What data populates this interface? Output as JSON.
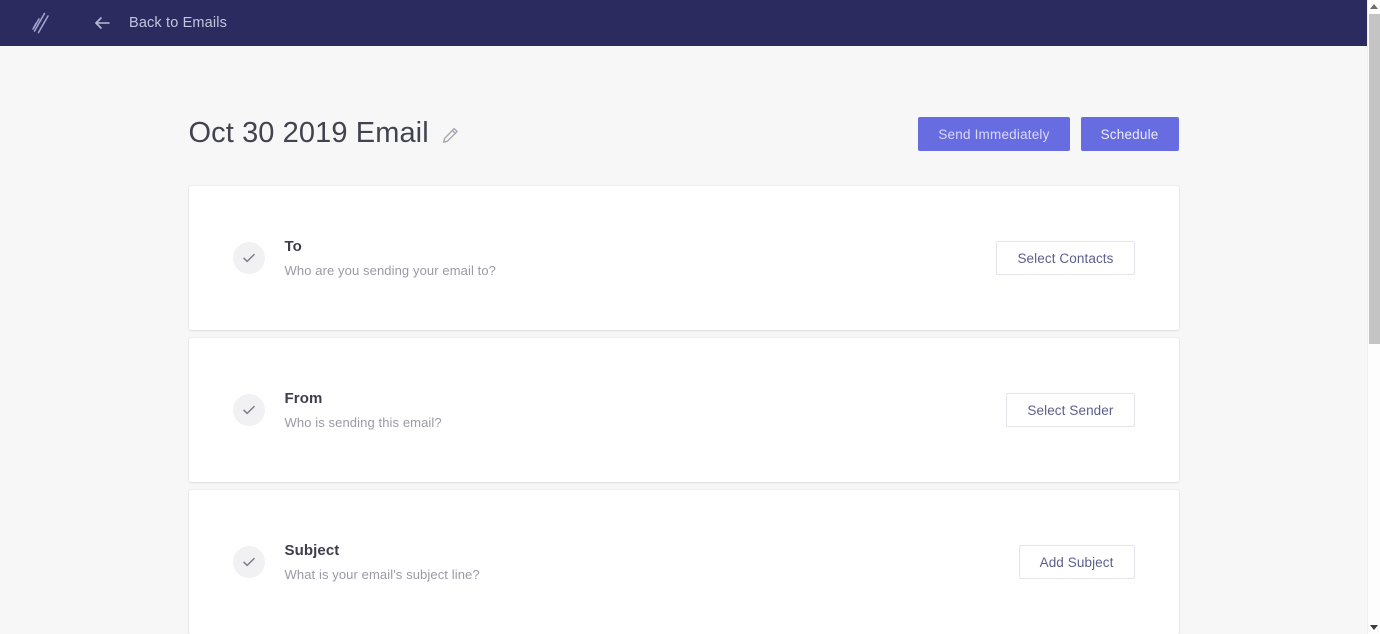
{
  "topbar": {
    "logo_name": "brand-logo",
    "back_label": "Back to Emails",
    "background_color": "#2b2b5f"
  },
  "header": {
    "title": "Oct 30 2019 Email",
    "edit_icon": "pencil-icon",
    "actions": [
      {
        "label": "Send Immediately",
        "style": "primary",
        "name": "send-immediately-button"
      },
      {
        "label": "Schedule",
        "style": "primary",
        "name": "schedule-button"
      }
    ],
    "accent_color": "#676ce0"
  },
  "cards": [
    {
      "title": "To",
      "subtitle": "Who are you sending your email to?",
      "action_label": "Select Contacts",
      "status_icon": "check-icon",
      "name": "card-to"
    },
    {
      "title": "From",
      "subtitle": "Who is sending this email?",
      "action_label": "Select Sender",
      "status_icon": "check-icon",
      "name": "card-from"
    },
    {
      "title": "Subject",
      "subtitle": "What is your email's subject line?",
      "action_label": "Add Subject",
      "status_icon": "check-icon",
      "name": "card-subject"
    }
  ],
  "scrollbar": {
    "up_icon": "scroll-up-arrow-icon",
    "down_icon": "scroll-down-arrow-icon"
  }
}
